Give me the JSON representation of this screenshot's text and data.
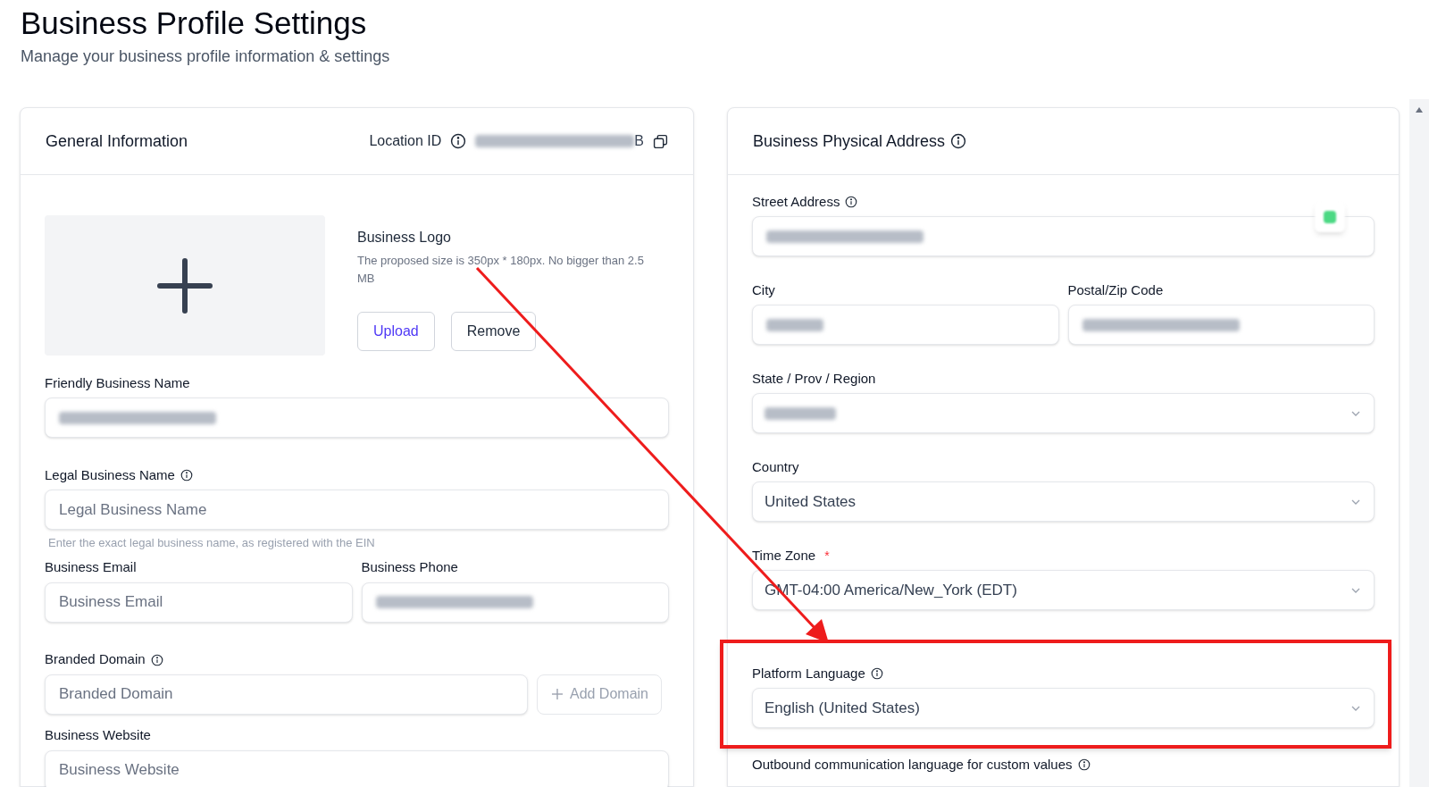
{
  "page": {
    "title": "Business Profile Settings",
    "subtitle": "Manage your business profile information & settings"
  },
  "general": {
    "title": "General Information",
    "location_id": {
      "label": "Location ID",
      "value": "B",
      "redacted": true
    },
    "logo": {
      "label": "Business Logo",
      "hint": "The proposed size is 350px * 180px. No bigger than 2.5 MB",
      "buttons": [
        {
          "label": "Upload",
          "kind": "primary"
        },
        {
          "label": "Remove",
          "kind": "default"
        }
      ]
    },
    "fields": [
      {
        "kind": "input",
        "label": "Friendly Business Name",
        "redacted": true
      },
      {
        "kind": "input",
        "label": "Legal Business Name",
        "info": true,
        "placeholder": "Legal Business Name",
        "help": "Enter the exact legal business name, as registered with the EIN"
      },
      {
        "kind": "pair",
        "items": [
          {
            "label": "Business Email",
            "placeholder": "Business Email"
          },
          {
            "label": "Business Phone",
            "redacted": true
          }
        ]
      },
      {
        "kind": "input-button",
        "label": "Branded Domain",
        "info": true,
        "placeholder": "Branded Domain",
        "button": "Add Domain"
      },
      {
        "kind": "input",
        "label": "Business Website",
        "placeholder": "Business Website"
      }
    ]
  },
  "address": {
    "title": "Business Physical Address",
    "info": true,
    "fields": [
      {
        "kind": "input",
        "label": "Street Address",
        "info": true,
        "redacted": true
      },
      {
        "kind": "pair",
        "items": [
          {
            "label": "City",
            "redacted": true
          },
          {
            "label": "Postal/Zip Code",
            "redacted": true
          }
        ]
      },
      {
        "kind": "select",
        "label": "State / Prov / Region",
        "redacted": true
      },
      {
        "kind": "select",
        "label": "Country",
        "value": "United States"
      },
      {
        "kind": "select",
        "label": "Time Zone",
        "required_mark": "*",
        "value": "GMT-04:00 America/New_York (EDT)"
      },
      {
        "kind": "select",
        "label": "Platform Language",
        "info": true,
        "value": "English (United States)",
        "highlighted": true
      },
      {
        "kind": "label",
        "label": "Outbound communication language for custom values",
        "info": true
      }
    ]
  },
  "annotations": [
    {
      "kind": "arrow"
    }
  ]
}
